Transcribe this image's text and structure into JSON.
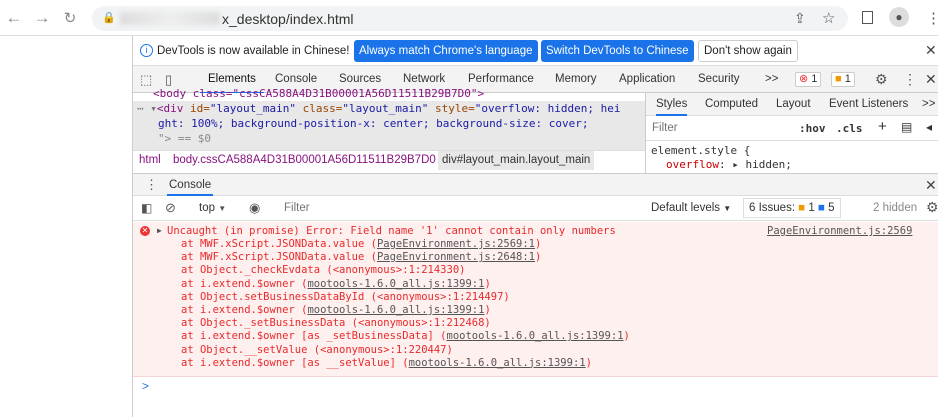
{
  "browser": {
    "url": "x_desktop/index.html"
  },
  "infobar": {
    "message": "DevTools is now available in Chinese!",
    "btn_match": "Always match Chrome's language",
    "btn_switch": "Switch DevTools to Chinese",
    "btn_dismiss": "Don't show again"
  },
  "tabs": [
    "Elements",
    "Console",
    "Sources",
    "Network",
    "Performance",
    "Memory",
    "Application",
    "Security"
  ],
  "tabs_more": ">>",
  "error_count": "1",
  "warning_count": "1",
  "dom": {
    "line0": "<body class=\"cssCA588A4D31B00001A56D11511B29B7D0\">",
    "line1_tag": "<div",
    "line1_id_attr": " id=",
    "line1_id": "\"layout_main\"",
    "line1_class_attr": " class=",
    "line1_class": "\"layout_main\"",
    "line1_style_attr": " style=",
    "line1_style": "\"overflow: hidden; hei",
    "line2": "ght: 100%; background-position-x: center; background-size: cover;",
    "line3": "\"> == $0"
  },
  "breadcrumbs": [
    "html",
    "body.cssCA588A4D31B00001A56D11511B29B7D0",
    "div#layout_main.layout_main"
  ],
  "styles": {
    "tabs": [
      "Styles",
      "Computed",
      "Layout",
      "Event Listeners"
    ],
    "more": ">>",
    "filter_placeholder": "Filter",
    "hov": ":hov",
    "cls": ".cls",
    "rule": "element.style {",
    "prop": "overflow",
    "propval": "hidden;"
  },
  "drawer": {
    "title": "Console"
  },
  "console_toolbar": {
    "context": "top",
    "filter_placeholder": "Filter",
    "levels": "Default levels",
    "issues_label": "6 Issues:",
    "issues_warn": "1",
    "issues_info": "5",
    "hidden": "2 hidden"
  },
  "error": {
    "message": "Uncaught (in promise) Error: Field name '1' cannot contain only numbers",
    "source": "PageEnvironment.js:2569",
    "stack": [
      {
        "text": "at MWF.xScript.JSONData.value (",
        "link": "PageEnvironment.js:2569:1",
        "end": ")"
      },
      {
        "text": "at MWF.xScript.JSONData.value (",
        "link": "PageEnvironment.js:2648:1",
        "end": ")"
      },
      {
        "text": "at Object._checkEvdata (<anonymous>:1:214330)",
        "link": "",
        "end": ""
      },
      {
        "text": "at i.extend.$owner (",
        "link": "mootools-1.6.0_all.js:1399:1",
        "end": ")"
      },
      {
        "text": "at Object.setBusinessDataById (<anonymous>:1:214497)",
        "link": "",
        "end": ""
      },
      {
        "text": "at i.extend.$owner (",
        "link": "mootools-1.6.0_all.js:1399:1",
        "end": ")"
      },
      {
        "text": "at Object._setBusinessData (<anonymous>:1:212468)",
        "link": "",
        "end": ""
      },
      {
        "text": "at i.extend.$owner [as _setBusinessData] (",
        "link": "mootools-1.6.0_all.js:1399:1",
        "end": ")"
      },
      {
        "text": "at Object.__setValue (<anonymous>:1:220447)",
        "link": "",
        "end": ""
      },
      {
        "text": "at i.extend.$owner [as __setValue] (",
        "link": "mootools-1.6.0_all.js:1399:1",
        "end": ")"
      }
    ]
  },
  "prompt": ">"
}
